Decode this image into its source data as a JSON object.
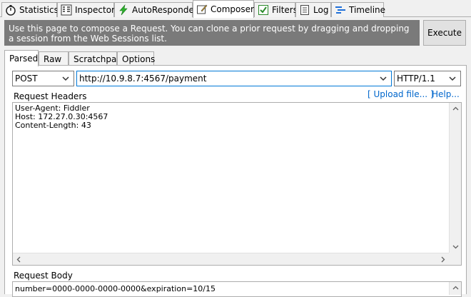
{
  "tabs": [
    {
      "label": "Statistics",
      "icon": "stopwatch-icon"
    },
    {
      "label": "Inspectors",
      "icon": "inspectors-icon"
    },
    {
      "label": "AutoResponder",
      "icon": "lightning-icon"
    },
    {
      "label": "Composer",
      "icon": "compose-icon"
    },
    {
      "label": "Filters",
      "icon": "checkbox-icon"
    },
    {
      "label": "Log",
      "icon": "log-icon"
    },
    {
      "label": "Timeline",
      "icon": "timeline-icon"
    }
  ],
  "active_tab": "Composer",
  "banner": {
    "text": "Use this page to compose a Request. You can clone a prior request by dragging and dropping a session from the Web Sessions list."
  },
  "execute_label": "Execute",
  "inner_tabs": [
    "Parsed",
    "Raw",
    "Scratchpad",
    "Options"
  ],
  "active_inner_tab": "Parsed",
  "request_line": {
    "method": "POST",
    "url": "http://10.9.8.7:4567/payment",
    "version": "HTTP/1.1"
  },
  "headers_section": {
    "label": "Request Headers",
    "upload_link": "[ Upload file... ]",
    "help_link": "Help...",
    "lines": [
      "User-Agent: Fiddler",
      "Host: 172.27.0.30:4567",
      "Content-Length: 43"
    ]
  },
  "body_section": {
    "label": "Request Body",
    "text": "number=0000-0000-0000-0000&expiration=10/15"
  },
  "colors": {
    "banner_bg": "#7a7a7a",
    "link": "#0066cc",
    "focus_border": "#0078d7"
  }
}
